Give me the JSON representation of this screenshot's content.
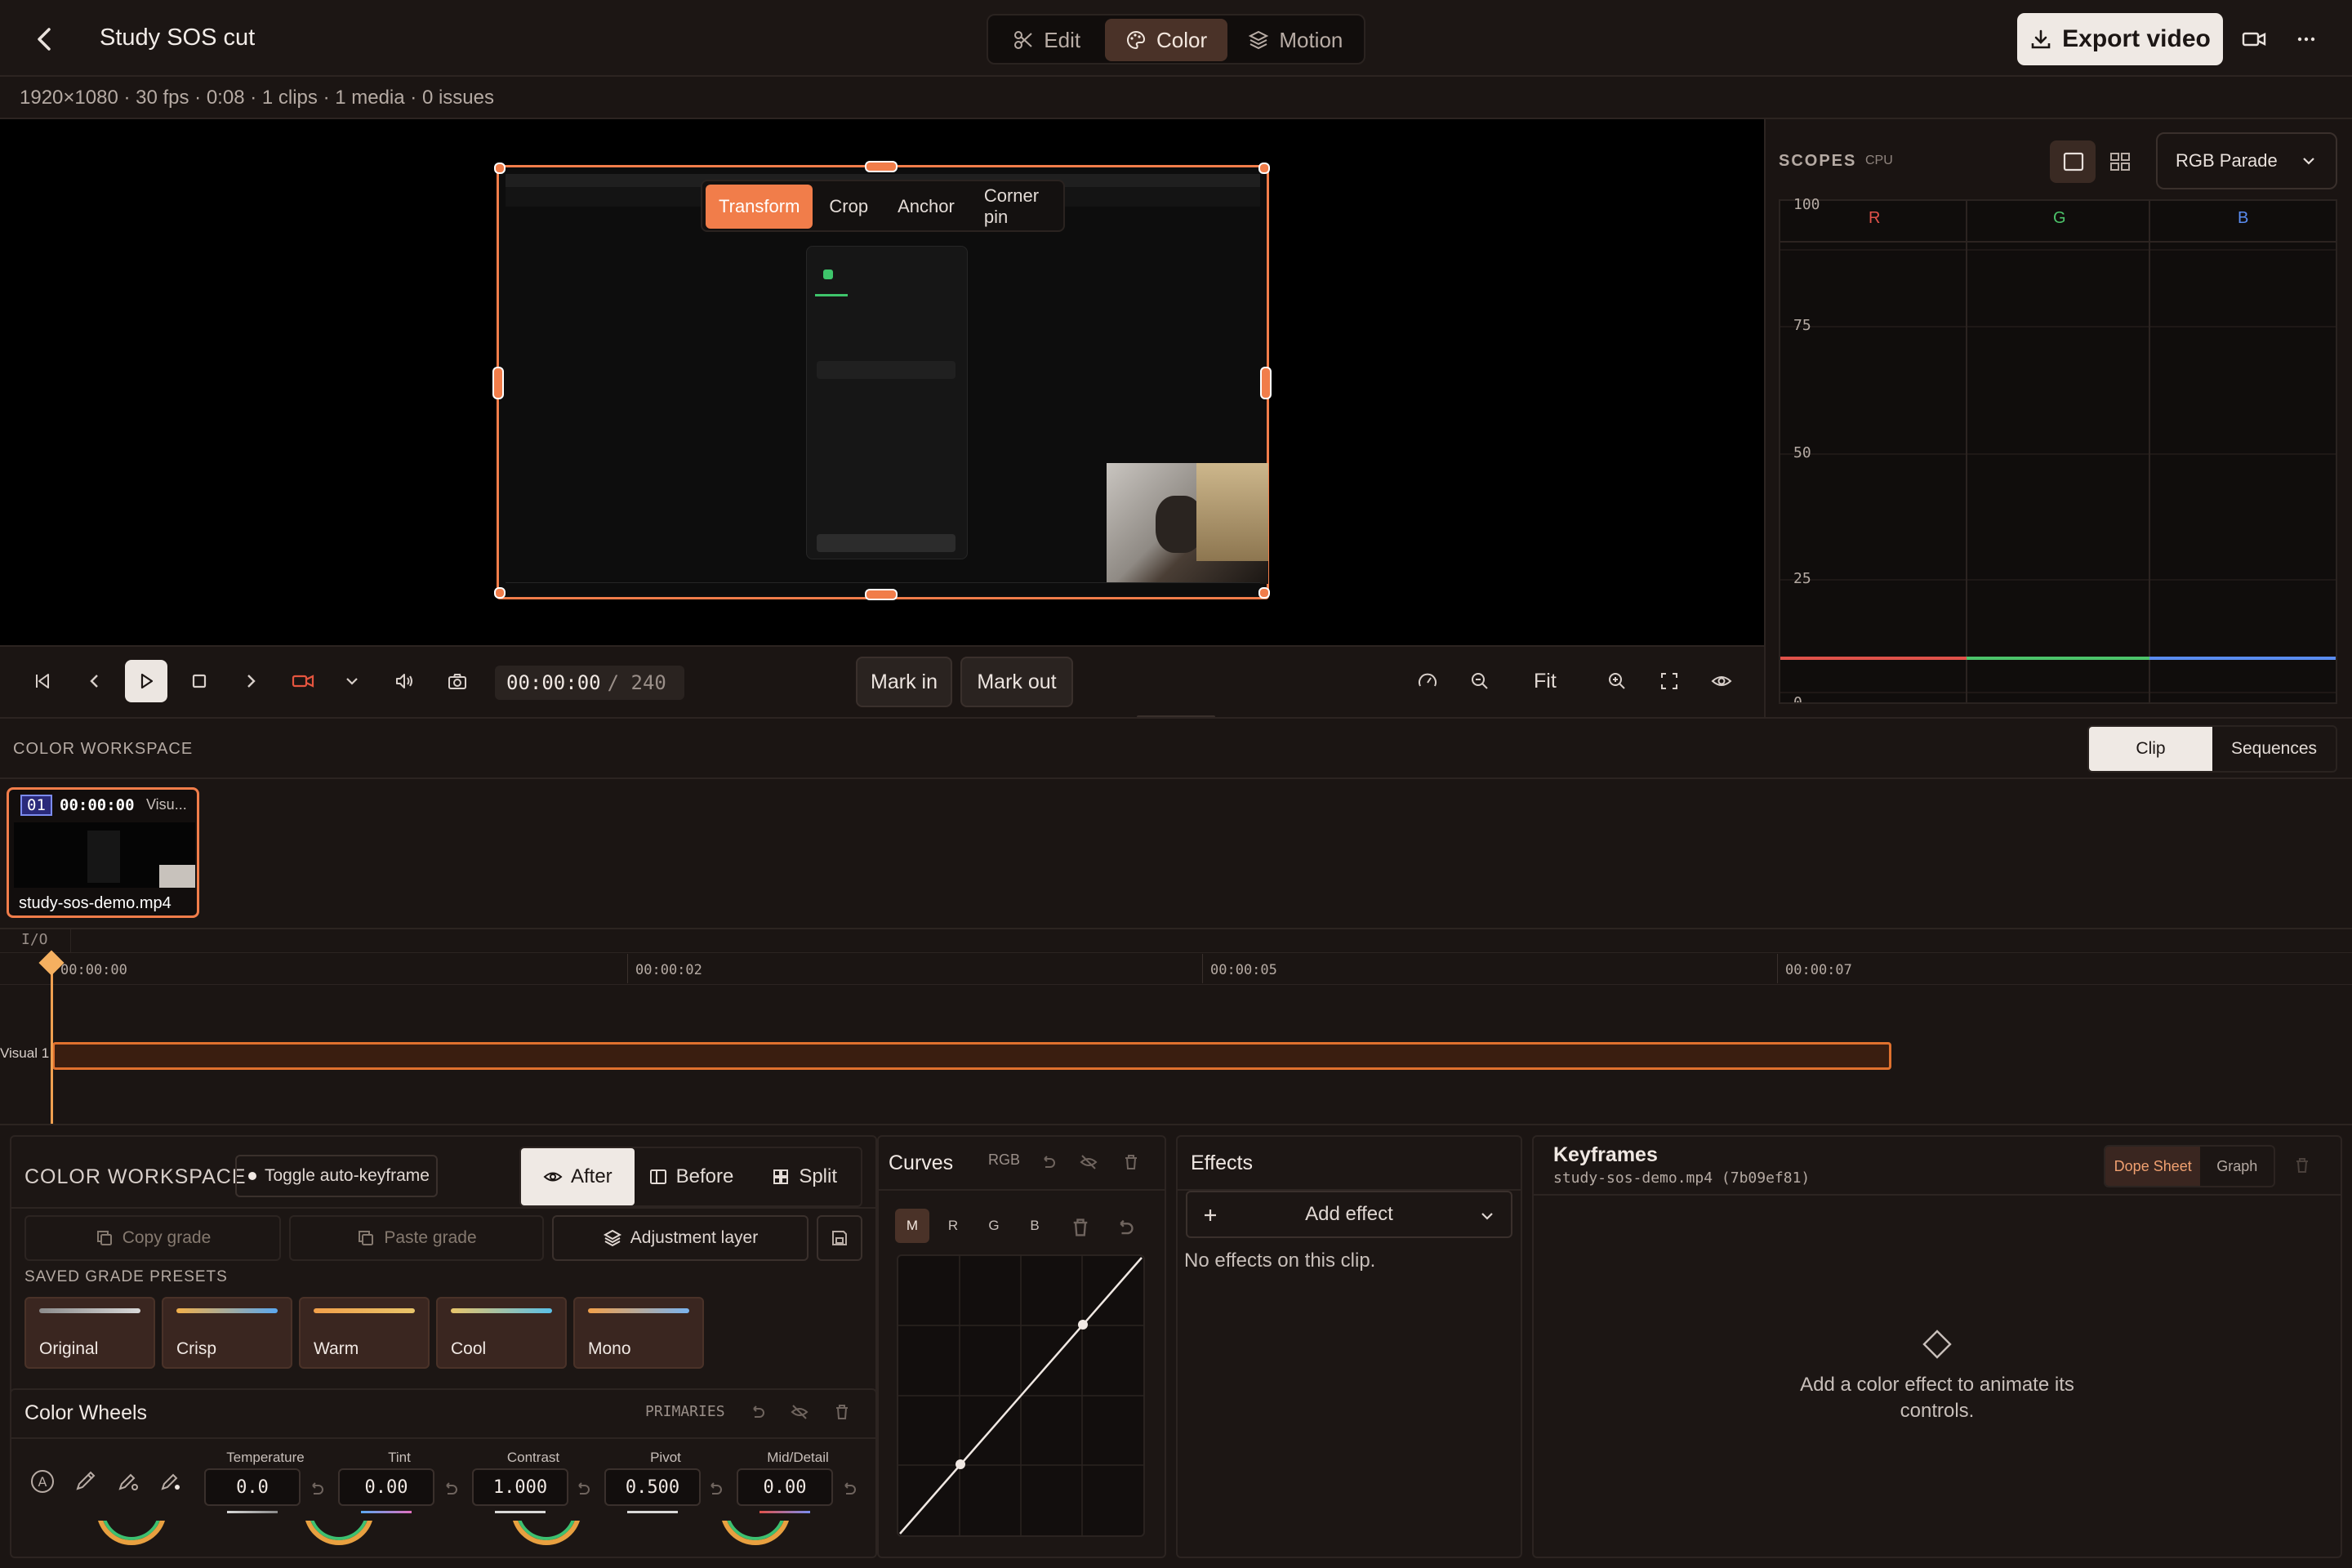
{
  "header": {
    "project_title": "Study SOS cut",
    "mode_tabs": [
      "Edit",
      "Color",
      "Motion"
    ],
    "active_mode": "Color",
    "export_label": "Export video",
    "meta": "1920×1080 · 30 fps · 0:08 · 1 clips · 1 media · 0 issues"
  },
  "preview": {
    "transform_tabs": [
      "Transform",
      "Crop",
      "Anchor",
      "Corner pin"
    ],
    "active_transform": "Transform"
  },
  "transport": {
    "timecode": "00:00:00",
    "total": "/ 240",
    "mark_in": "Mark in",
    "mark_out": "Mark out",
    "fit": "Fit"
  },
  "scopes": {
    "title": "SCOPES",
    "backend": "CPU",
    "mode": "RGB Parade",
    "channels": [
      "R",
      "G",
      "B"
    ],
    "y_ticks": [
      "100",
      "75",
      "50",
      "25",
      "0"
    ],
    "channel_colors": [
      "#e0524a",
      "#4cc36a",
      "#5a8cf0"
    ]
  },
  "workspace": {
    "title": "COLOR WORKSPACE",
    "view_tabs": [
      "Clip",
      "Sequences"
    ],
    "active_view": "Clip"
  },
  "clip": {
    "index": "01",
    "timecode": "00:00:00",
    "track": "Visu...",
    "name": "study-sos-demo.mp4"
  },
  "timeline": {
    "io": "I/O",
    "ruler": [
      "00:00:00",
      "00:00:02",
      "00:00:05",
      "00:00:07"
    ],
    "track_label": "Visual 1"
  },
  "color_panel": {
    "title": "COLOR WORKSPACE",
    "toggle": "Toggle auto-keyframe",
    "compare": [
      "After",
      "Before",
      "Split"
    ],
    "active_compare": "After",
    "copy": "Copy grade",
    "paste": "Paste grade",
    "adjust": "Adjustment layer",
    "presets_title": "SAVED GRADE PRESETS",
    "presets": [
      "Original",
      "Crisp",
      "Warm",
      "Cool",
      "Mono"
    ],
    "wheels_title": "Color Wheels",
    "wheels_mode": "PRIMARIES",
    "fields": [
      {
        "label": "Temperature",
        "value": "0.0"
      },
      {
        "label": "Tint",
        "value": "0.00"
      },
      {
        "label": "Contrast",
        "value": "1.000"
      },
      {
        "label": "Pivot",
        "value": "0.500"
      },
      {
        "label": "Mid/Detail",
        "value": "0.00"
      }
    ]
  },
  "curves": {
    "title": "Curves",
    "mode": "RGB",
    "channels": [
      "M",
      "R",
      "G",
      "B"
    ],
    "active_channel": "M"
  },
  "effects": {
    "title": "Effects",
    "add": "Add effect",
    "empty": "No effects on this clip."
  },
  "keyframes": {
    "title": "Keyframes",
    "subtitle": "study-sos-demo.mp4 (7b09ef81)",
    "tabs": [
      "Dope Sheet",
      "Graph"
    ],
    "active_tab": "Dope Sheet",
    "empty": "Add a color effect to animate its controls."
  },
  "colors": {
    "accent": "#f17d4a",
    "background": "#1b1513"
  }
}
